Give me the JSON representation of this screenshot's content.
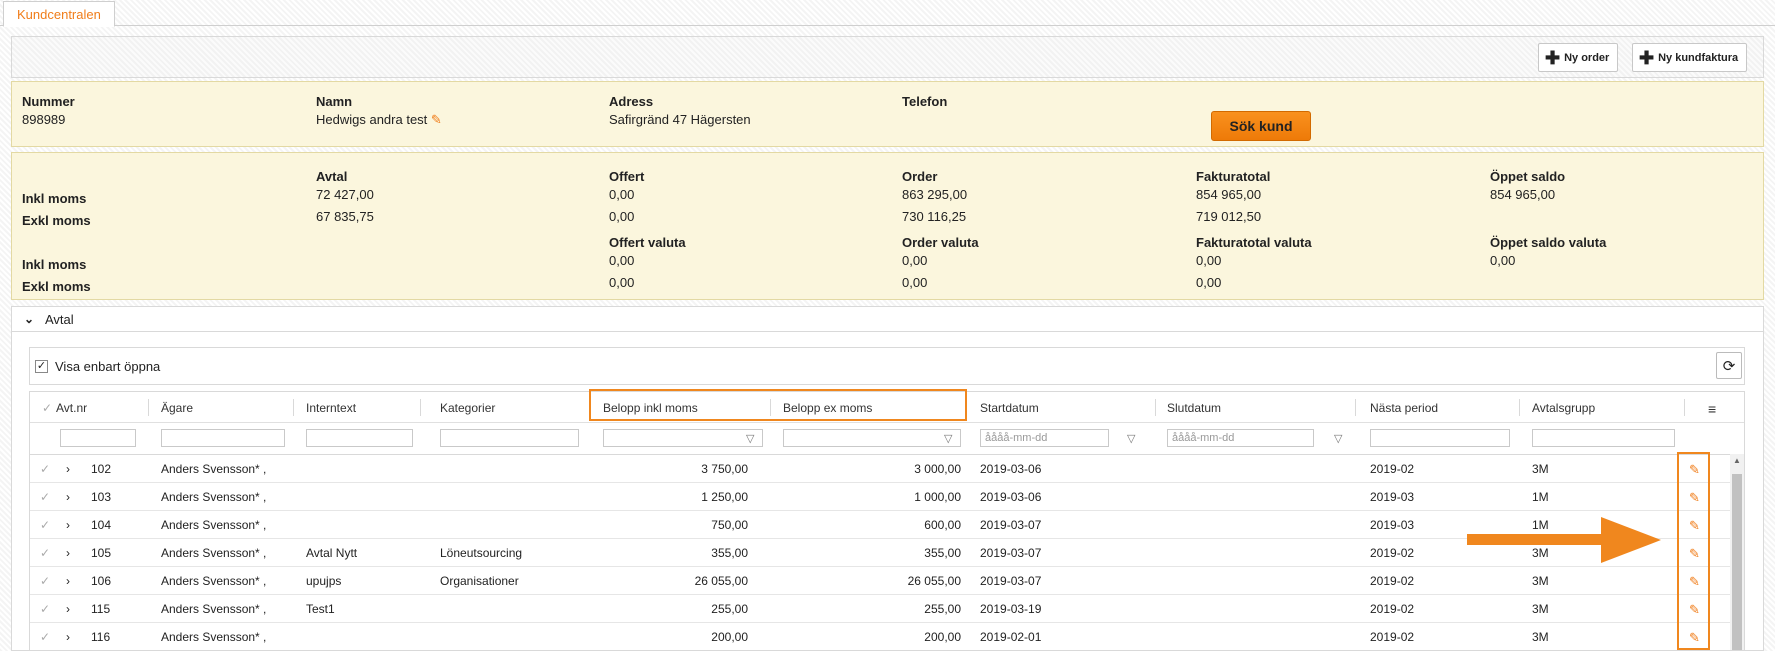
{
  "tab": {
    "label": "Kundcentralen"
  },
  "toolbar": {
    "new_order": "Ny order",
    "new_invoice": "Ny kundfaktura"
  },
  "customer": {
    "number_label": "Nummer",
    "number": "898989",
    "name_label": "Namn",
    "name": "Hedwigs andra test",
    "address_label": "Adress",
    "address": "Safirgränd 47 Hägersten",
    "phone_label": "Telefon",
    "phone": "",
    "search_button": "Sök kund"
  },
  "totals": {
    "inkl": "Inkl moms",
    "exkl": "Exkl moms",
    "avtal": {
      "label": "Avtal",
      "inkl": "72 427,00",
      "exkl": "67 835,75"
    },
    "offert": {
      "label": "Offert",
      "inkl": "0,00",
      "exkl": "0,00"
    },
    "order": {
      "label": "Order",
      "inkl": "863 295,00",
      "exkl": "730 116,25"
    },
    "faktura": {
      "label": "Fakturatotal",
      "inkl": "854 965,00",
      "exkl": "719 012,50"
    },
    "oppet": {
      "label": "Öppet saldo",
      "inkl": "854 965,00"
    },
    "offert_valuta": {
      "label": "Offert valuta",
      "inkl": "0,00",
      "exkl": "0,00"
    },
    "order_valuta": {
      "label": "Order valuta",
      "inkl": "0,00",
      "exkl": "0,00"
    },
    "faktura_valuta": {
      "label": "Fakturatotal valuta",
      "inkl": "0,00",
      "exkl": "0,00"
    },
    "oppet_valuta": {
      "label": "Öppet saldo valuta",
      "inkl": "0,00"
    }
  },
  "section": {
    "title": "Avtal",
    "only_open": "Visa enbart öppna"
  },
  "columns": {
    "avtnr": "Avt.nr",
    "agare": "Ägare",
    "internext": "Interntext",
    "kategorier": "Kategorier",
    "belopp_inkl": "Belopp inkl moms",
    "belopp_ex": "Belopp ex moms",
    "startdatum": "Startdatum",
    "slutdatum": "Slutdatum",
    "nasta": "Nästa period",
    "grupp": "Avtalsgrupp"
  },
  "filters": {
    "date_placeholder": "åååå-mm-dd"
  },
  "rows": [
    {
      "nr": "102",
      "agare": "Anders Svensson* ,",
      "intern": "",
      "kat": "",
      "inkl": "3 750,00",
      "ex": "3 000,00",
      "start": "2019-03-06",
      "slut": "",
      "nasta": "2019-02",
      "grupp": "3M"
    },
    {
      "nr": "103",
      "agare": "Anders Svensson* ,",
      "intern": "",
      "kat": "",
      "inkl": "1 250,00",
      "ex": "1 000,00",
      "start": "2019-03-06",
      "slut": "",
      "nasta": "2019-03",
      "grupp": "1M"
    },
    {
      "nr": "104",
      "agare": "Anders Svensson* ,",
      "intern": "",
      "kat": "",
      "inkl": "750,00",
      "ex": "600,00",
      "start": "2019-03-07",
      "slut": "",
      "nasta": "2019-03",
      "grupp": "1M"
    },
    {
      "nr": "105",
      "agare": "Anders Svensson* ,",
      "intern": "Avtal Nytt",
      "kat": "Löneutsourcing",
      "inkl": "355,00",
      "ex": "355,00",
      "start": "2019-03-07",
      "slut": "",
      "nasta": "2019-02",
      "grupp": "3M"
    },
    {
      "nr": "106",
      "agare": "Anders Svensson* ,",
      "intern": "upujps",
      "kat": "Organisationer",
      "inkl": "26 055,00",
      "ex": "26 055,00",
      "start": "2019-03-07",
      "slut": "",
      "nasta": "2019-02",
      "grupp": "3M"
    },
    {
      "nr": "115",
      "agare": "Anders Svensson* ,",
      "intern": "Test1",
      "kat": "",
      "inkl": "255,00",
      "ex": "255,00",
      "start": "2019-03-19",
      "slut": "",
      "nasta": "2019-02",
      "grupp": "3M"
    },
    {
      "nr": "116",
      "agare": "Anders Svensson* ,",
      "intern": "",
      "kat": "",
      "inkl": "200,00",
      "ex": "200,00",
      "start": "2019-02-01",
      "slut": "",
      "nasta": "2019-02",
      "grupp": "3M"
    }
  ],
  "colors": {
    "accent": "#f07d1a",
    "panel": "#fbf6dd",
    "highlight": "#f0871e"
  }
}
